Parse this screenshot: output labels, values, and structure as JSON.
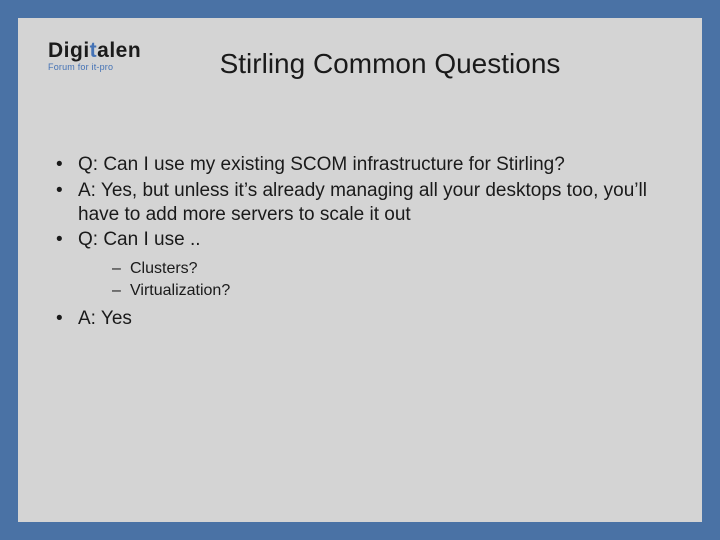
{
  "logo": {
    "part1": "Digi",
    "part2": "t",
    "part3": "alen",
    "sub": "Forum for it-pro"
  },
  "title": "Stirling Common Questions",
  "bullets": {
    "b1": "Q:  Can I use my existing SCOM infrastructure for Stirling?",
    "b2": "A:  Yes, but unless it’s already managing all your desktops too, you’ll have to add more servers to scale it out",
    "b3": "Q:  Can I use ..",
    "sub1": "Clusters?",
    "sub2": "Virtualization?",
    "b4": "A:  Yes"
  }
}
